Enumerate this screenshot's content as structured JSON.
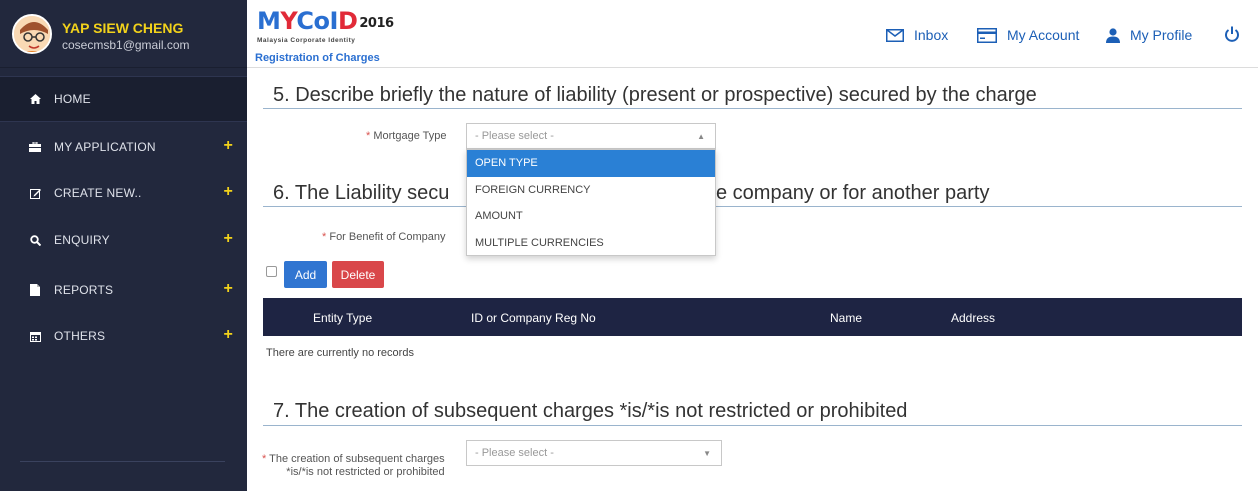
{
  "user": {
    "name": "YAP SIEW CHENG",
    "email": "cosecmsb1@gmail.com"
  },
  "sidebar": {
    "items": [
      {
        "label": "HOME",
        "icon": "home-icon",
        "expandable": false
      },
      {
        "label": "MY APPLICATION",
        "icon": "briefcase-icon",
        "expandable": true
      },
      {
        "label": "CREATE NEW..",
        "icon": "edit-icon",
        "expandable": true
      },
      {
        "label": "ENQUIRY",
        "icon": "search-icon",
        "expandable": true
      },
      {
        "label": "REPORTS",
        "icon": "document-icon",
        "expandable": true
      },
      {
        "label": "OTHERS",
        "icon": "calendar-icon",
        "expandable": true
      }
    ],
    "plus": "+"
  },
  "header": {
    "logo_m": "M",
    "logo_y": "Y",
    "logo_coi": "CoI",
    "logo_d": "D",
    "logo_year": "2016",
    "logo_subtitle": "Malaysia Corporate Identity",
    "page_title": "Registration of Charges",
    "inbox": "Inbox",
    "my_account": "My Account",
    "my_profile": "My Profile"
  },
  "section5": {
    "title": "5. Describe briefly the nature of liability (present or prospective) secured by the charge",
    "mortgage_label": "Mortgage Type",
    "mortgage_placeholder": "- Please select -",
    "options": [
      "OPEN TYPE",
      "FOREIGN CURRENCY",
      "AMOUNT",
      "MULTIPLE CURRENCIES"
    ],
    "highlighted_option": "OPEN TYPE"
  },
  "section6": {
    "title_left": "6. The Liability secu",
    "title_right": "e company or for another party",
    "benefit_label": "For Benefit of Company",
    "add_label": "Add",
    "delete_label": "Delete",
    "columns": [
      "Entity Type",
      "ID or Company Reg No",
      "Name",
      "Address"
    ],
    "empty_message": "There are currently no records"
  },
  "section7": {
    "title": "7. The creation of subsequent charges *is/*is not restricted or prohibited",
    "label_line1": "The creation of subsequent charges",
    "label_line2": "*is/*is not restricted or prohibited",
    "placeholder": "- Please select -"
  },
  "required_mark": "*",
  "colors": {
    "sidebar_bg": "#22283d",
    "username": "#f2d21b",
    "link_blue": "#1c5fb6",
    "table_header": "#1e2443",
    "add_button": "#3075d1",
    "delete_button": "#d9474a",
    "dropdown_highlight": "#2a80d5"
  }
}
